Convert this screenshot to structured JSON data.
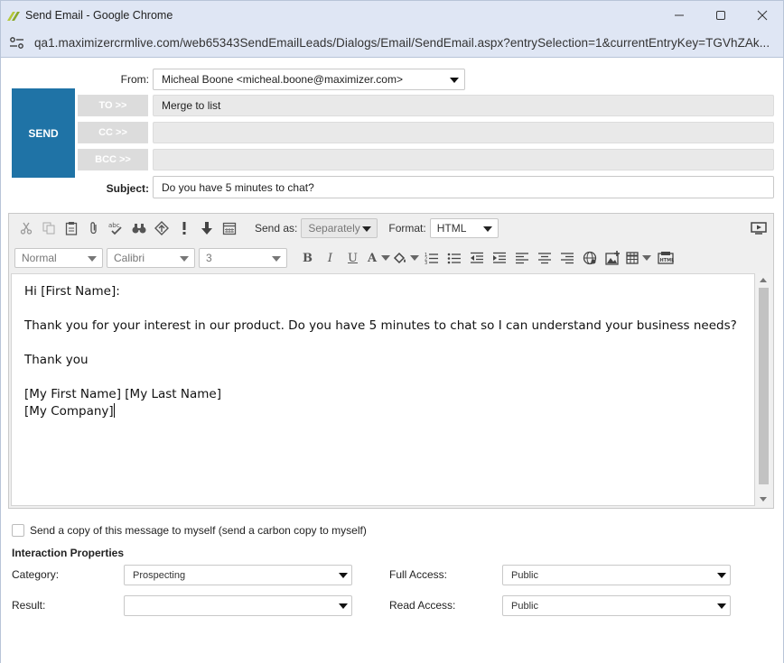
{
  "window": {
    "title": "Send Email - Google Chrome",
    "url": "qa1.maximizercrmlive.com/web65343SendEmailLeads/Dialogs/Email/SendEmail.aspx?entrySelection=1&currentEntryKey=TGVhZAk..."
  },
  "header": {
    "from_label": "From:",
    "from_value": "Micheal Boone <micheal.boone@maximizer.com>",
    "send_label": "SEND",
    "to_label": "TO >>",
    "to_value": "Merge to list",
    "cc_label": "CC >>",
    "cc_value": "",
    "bcc_label": "BCC >>",
    "bcc_value": "",
    "subject_label": "Subject:",
    "subject_value": "Do you have 5 minutes to chat?"
  },
  "toolbar": {
    "send_as_label": "Send as:",
    "send_as_value": "Separately",
    "format_label": "Format:",
    "format_value": "HTML",
    "style_value": "Normal",
    "font_value": "Calibri",
    "size_value": "3"
  },
  "body": {
    "line1": "Hi [First Name]:",
    "line2": "Thank you for your interest in our product. Do you have 5 minutes to chat so I can understand your business needs?",
    "line3": "Thank you",
    "line4": "[My First Name] [My Last Name]",
    "line5": "[My Company]"
  },
  "footer": {
    "copy_label": "Send a copy of this message to myself (send a carbon copy to myself)",
    "section_title": "Interaction Properties",
    "category_label": "Category:",
    "category_value": "Prospecting",
    "result_label": "Result:",
    "result_value": "",
    "full_access_label": "Full Access:",
    "full_access_value": "Public",
    "read_access_label": "Read Access:",
    "read_access_value": "Public"
  }
}
